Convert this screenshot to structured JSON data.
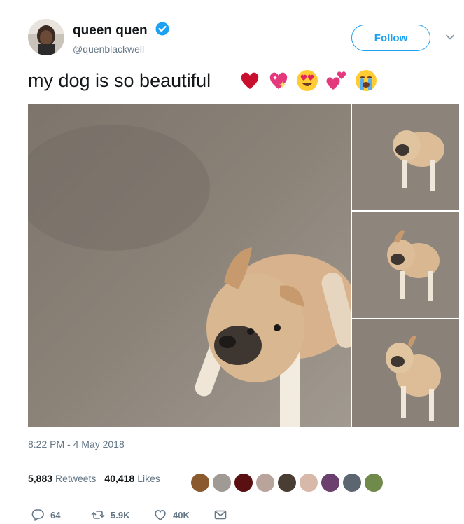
{
  "user": {
    "display_name": "queen quen",
    "handle": "@quenblackwell",
    "follow_label": "Follow"
  },
  "tweet": {
    "text": "my dog is so beautiful",
    "emojis": [
      "red-heart-icon",
      "sparkling-heart-icon",
      "heart-eyes-face-icon",
      "two-hearts-icon",
      "loudly-crying-face-icon"
    ],
    "timestamp": "8:22 PM - 4 May 2018"
  },
  "stats": {
    "retweets_count": "5,883",
    "retweets_label": "Retweets",
    "likes_count": "40,418",
    "likes_label": "Likes"
  },
  "actions": {
    "replies": "64",
    "retweets": "5.9K",
    "likes": "40K"
  },
  "colors": {
    "accent": "#1da1f2",
    "text": "#14171a",
    "muted": "#657786"
  }
}
